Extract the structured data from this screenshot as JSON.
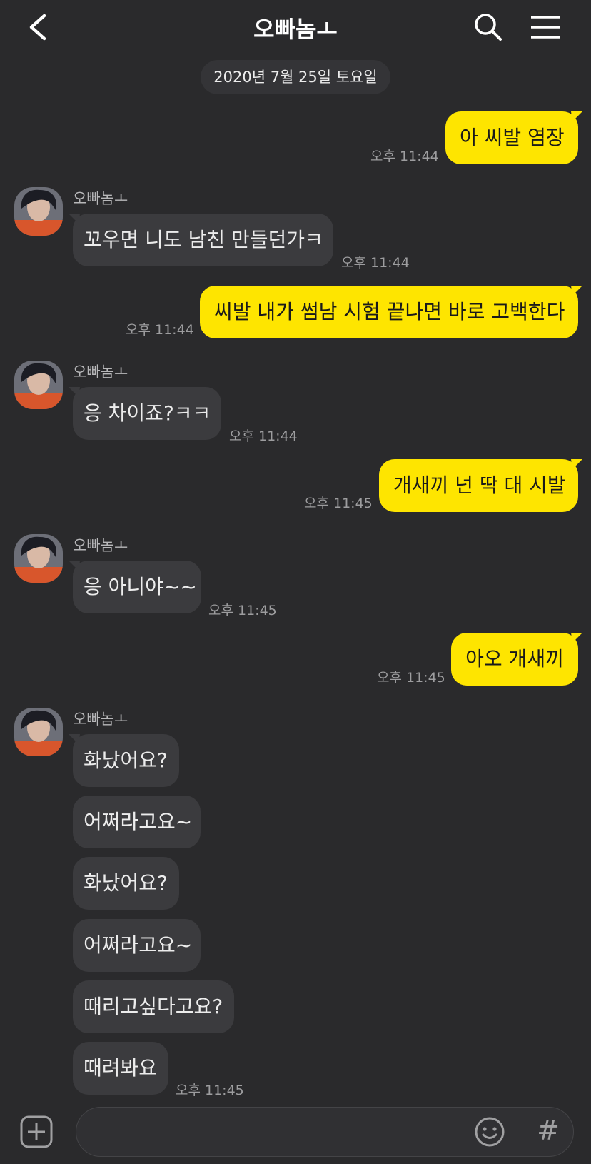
{
  "header": {
    "title": "오빠놈ㅗ",
    "back_icon": "back-chevron-icon",
    "search_icon": "search-icon",
    "menu_icon": "hamburger-menu-icon"
  },
  "date_divider": "2020년 7월 25일 토요일",
  "colors": {
    "background": "#2a2a2c",
    "my_bubble": "#fee500",
    "other_bubble": "#3b3b3e",
    "time_text": "#9d9d9f"
  },
  "messages": [
    {
      "from": "me",
      "text": "아 씨발 염장",
      "time": "오후 11:44"
    },
    {
      "from": "other",
      "sender": "오빠놈ㅗ",
      "text": "꼬우면 니도 남친 만들던가ㅋ",
      "time": "오후 11:44"
    },
    {
      "from": "me",
      "text": "씨발 내가 썸남 시험 끝나면 바로 고백한다",
      "time": "오후 11:44"
    },
    {
      "from": "other",
      "sender": "오빠놈ㅗ",
      "text": "응 차이죠?ㅋㅋ",
      "time": "오후 11:44"
    },
    {
      "from": "me",
      "text": "개새끼 넌 딱 대 시발",
      "time": "오후 11:45"
    },
    {
      "from": "other",
      "sender": "오빠놈ㅗ",
      "text": "응 아니야~~",
      "time": "오후 11:45"
    },
    {
      "from": "me",
      "text": "아오 개새끼",
      "time": "오후 11:45"
    },
    {
      "from": "other",
      "sender": "오빠놈ㅗ",
      "lines": [
        "화났어요?",
        "어쩌라고요~",
        "화났어요?",
        "어쩌라고요~",
        "때리고싶다고요?",
        "때려봐요"
      ],
      "time": "오후 11:45"
    }
  ],
  "input": {
    "plus_icon": "plus-icon",
    "emoji_icon": "emoji-icon",
    "hash_label": "#"
  }
}
